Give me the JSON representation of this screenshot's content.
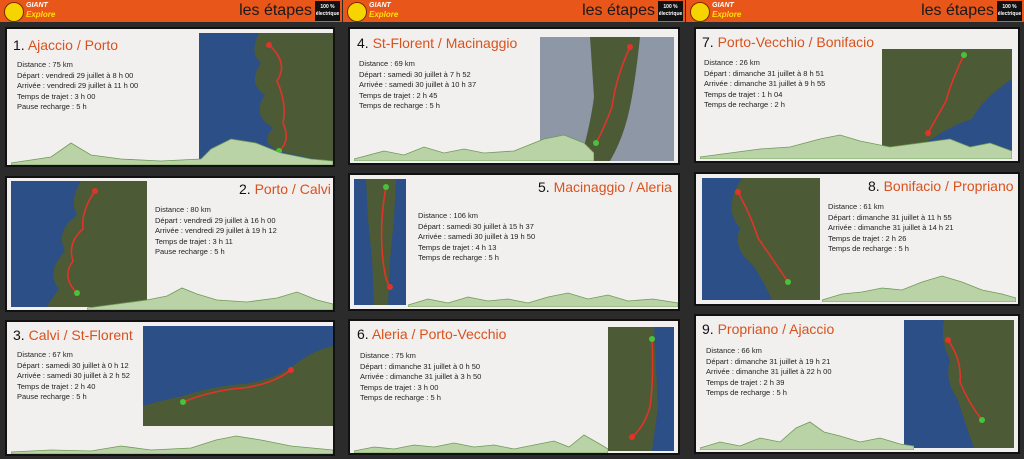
{
  "header": {
    "brand_top": "GIANT",
    "brand_bottom": "Explore",
    "title": "les étapes",
    "badge_line1": "100 %",
    "badge_line2": "électrique"
  },
  "stages": [
    {
      "num": "1.",
      "name": "Ajaccio / Porto",
      "lines": [
        "Distance : 75 km",
        "Départ : vendredi 29 juillet à 8 h 00",
        "Arrivée : vendredi 29 juillet à 11 h 00",
        "Temps de trajet : 3 h 00",
        "Pause recharge : 5 h"
      ]
    },
    {
      "num": "2.",
      "name": "Porto / Calvi",
      "lines": [
        "Distance : 80 km",
        "Départ : vendredi 29 juillet à 16 h 00",
        "Arrivée : vendredi 29 juillet à 19 h 12",
        "Temps de trajet : 3 h 11",
        "Pause recharge : 5 h"
      ]
    },
    {
      "num": "3.",
      "name": "Calvi / St-Florent",
      "lines": [
        "Distance : 67 km",
        "Départ : samedi 30 juillet à 0 h 12",
        "Arrivée : samedi 30 juillet à 2 h 52",
        "Temps de trajet : 2 h 40",
        "Pause recharge : 5 h"
      ]
    },
    {
      "num": "4.",
      "name": "St-Florent / Macinaggio",
      "lines": [
        "Distance : 69 km",
        "Départ : samedi 30 juillet à 7 h 52",
        "Arrivée : samedi 30 juillet à 10 h 37",
        "Temps de trajet : 2 h 45",
        "Temps de recharge : 5 h"
      ]
    },
    {
      "num": "5.",
      "name": "Macinaggio / Aleria",
      "lines": [
        "Distance : 106 km",
        "Départ : samedi 30 juillet à 15 h 37",
        "Arrivée : samedi 30 juillet à 19 h 50",
        "Temps de trajet : 4 h 13",
        "Temps de recharge : 5 h"
      ]
    },
    {
      "num": "6.",
      "name": "Aleria / Porto-Vecchio",
      "lines": [
        "Distance : 75 km",
        "Départ : dimanche 31 juillet à 0 h 50",
        "Arrivée : dimanche 31 juillet à 3 h 50",
        "Temps de trajet : 3 h 00",
        "Temps de recharge : 5 h"
      ]
    },
    {
      "num": "7.",
      "name": "Porto-Vecchio / Bonifacio",
      "lines": [
        "Distance : 26 km",
        "Départ : dimanche 31 juillet à 8 h 51",
        "Arrivée : dimanche 31 juillet à 9 h 55",
        "Temps de trajet : 1 h 04",
        "Temps de recharge : 2 h"
      ]
    },
    {
      "num": "8.",
      "name": "Bonifacio / Propriano",
      "lines": [
        "Distance : 61 km",
        "Départ : dimanche 31 juillet à 11 h 55",
        "Arrivée : dimanche 31 juillet à 14 h 21",
        "Temps de trajet : 2 h 26",
        "Temps de recharge : 5 h"
      ]
    },
    {
      "num": "9.",
      "name": "Propriano / Ajaccio",
      "lines": [
        "Distance : 66 km",
        "Départ : dimanche 31 juillet à 19 h 21",
        "Arrivée : dimanche 31 juillet à 22 h 00",
        "Temps de trajet : 2 h 39",
        "Temps de recharge : 5 h"
      ]
    }
  ],
  "colors": {
    "header": "#e8561a",
    "title_accent": "#d9521c",
    "card_bg": "#f2efef",
    "profile_fill": "#b9d3a6",
    "profile_line": "#6f9a55",
    "route": "#e0342a",
    "sea": "#2b4f86",
    "land": "#4d5a36"
  }
}
